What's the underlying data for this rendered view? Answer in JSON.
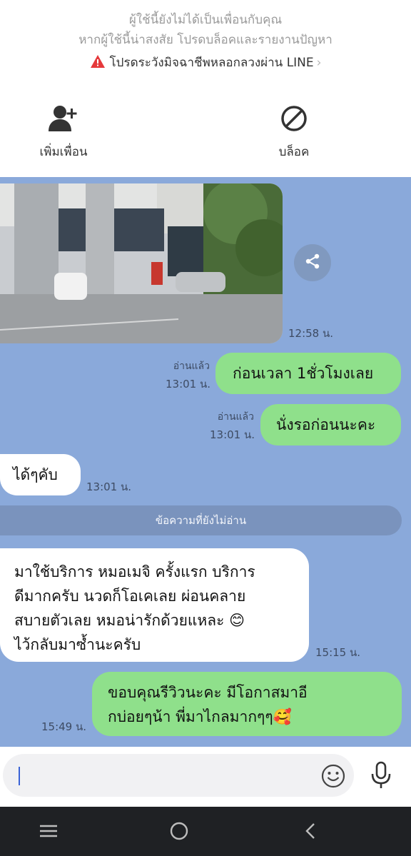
{
  "header": {
    "notice_line1": "ผู้ใช้นี้ยังไม่ได้เป็นเพื่อนกับคุณ",
    "notice_line2": "หากผู้ใช้นี้น่าสงสัย โปรดบล็อคและรายงานปัญหา",
    "scam_warning": "โปรดระวังมิจฉาชีพหลอกลวงผ่าน LINE",
    "chevron": "›",
    "add_friend_label": "เพิ่มเพื่อน",
    "block_label": "บล็อค"
  },
  "chat": {
    "photo_time": "12:58 น.",
    "messages": [
      {
        "side": "right",
        "text": "ก่อนเวลา 1ชั่วโมงเลย",
        "read": "อ่านแล้ว",
        "time": "13:01 น."
      },
      {
        "side": "right",
        "text": "นั่งรอก่อนนะคะ",
        "read": "อ่านแล้ว",
        "time": "13:01 น."
      },
      {
        "side": "left",
        "text": "ได้ๆคับ",
        "time": "13:01 น."
      }
    ],
    "unread_divider": "ข้อความที่ยังไม่อ่าน",
    "review": {
      "lines": [
        "มาใช้บริการ หมอเมจิ ครั้งแรก บริการ",
        "ดีมากครับ นวดก็โอเคเลย ผ่อนคลาย",
        "สบายตัวเลย หมอน่ารักด้วยแหละ 😊",
        "ไว้กลับมาซ้ำนะครับ"
      ],
      "time": "15:15 น."
    },
    "reply": {
      "lines": [
        "ขอบคุณรีวิวนะคะ มีโอกาสมาอี",
        "กบ่อยๆน้า พี่มาไกลมากๆๆ🥰"
      ],
      "time": "15:49 น."
    }
  },
  "input": {
    "placeholder": ""
  },
  "colors": {
    "chat_bg": "#8aa9da",
    "green_bubble": "#8fe08b",
    "alert_red": "#e5393b"
  },
  "icons": [
    "alert-triangle-icon",
    "add-friend-icon",
    "block-icon",
    "share-icon",
    "emoji-icon",
    "mic-icon",
    "recents-icon",
    "home-icon",
    "back-icon"
  ]
}
